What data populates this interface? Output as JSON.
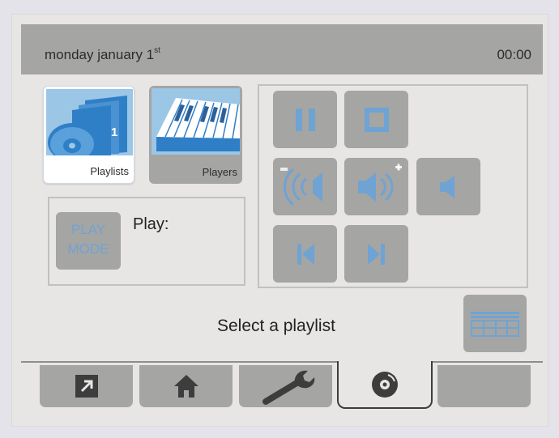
{
  "header": {
    "date": "monday january 1",
    "date_suffix": "st",
    "time": "00:00"
  },
  "tiles": {
    "playlists": {
      "label": "Playlists",
      "badge": "1"
    },
    "players": {
      "label": "Players"
    }
  },
  "play_mode": {
    "button_line1": "PLAY",
    "button_line2": "MODE",
    "label": "Play:"
  },
  "controls": [
    {
      "name": "pause-button",
      "icon": "pause-icon"
    },
    {
      "name": "stop-button",
      "icon": "stop-icon"
    },
    {
      "name": "volume-down-button",
      "icon": "volume-down-icon"
    },
    {
      "name": "volume-up-button",
      "icon": "volume-up-icon"
    },
    {
      "name": "mute-button",
      "icon": "mute-icon"
    },
    {
      "name": "previous-button",
      "icon": "skip-previous-icon"
    },
    {
      "name": "next-button",
      "icon": "skip-next-icon"
    }
  ],
  "status": "Select a playlist",
  "tabs": [
    {
      "name": "tab-exit",
      "icon": "arrow-out-icon"
    },
    {
      "name": "tab-home",
      "icon": "home-icon"
    },
    {
      "name": "tab-settings",
      "icon": "wrench-icon"
    },
    {
      "name": "tab-media",
      "icon": "disc-icon",
      "active": true
    },
    {
      "name": "tab-empty",
      "icon": ""
    }
  ],
  "colors": {
    "background": "#e4e3ea",
    "panel": "#e8e6e5",
    "header": "#a5a5a3",
    "button": "#a5a5a3",
    "icon_blue": "#6fa3d4",
    "icon_dark": "#3d3d3d"
  }
}
